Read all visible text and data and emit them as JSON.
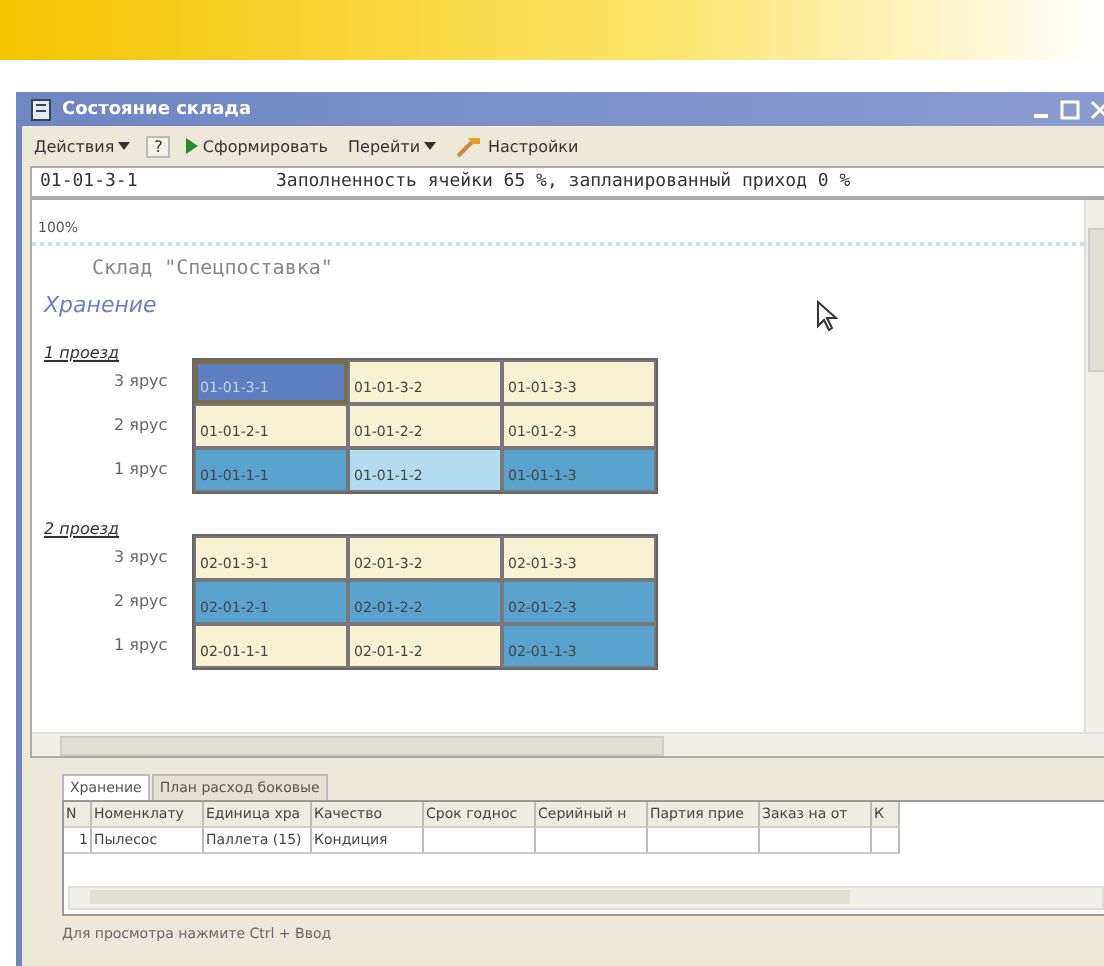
{
  "window": {
    "title": "Состояние склада"
  },
  "toolbar": [
    {
      "label": "Действия",
      "kind": "menu"
    },
    {
      "label": "?",
      "kind": "help"
    },
    {
      "label": "Сформировать",
      "kind": "run"
    },
    {
      "label": "Перейти",
      "kind": "menu"
    },
    {
      "label": "Настройки",
      "kind": "settings"
    }
  ],
  "info": {
    "cell": "01-01-3-1",
    "text": "Заполненность ячейки 65 %, запланированный приход 0 %"
  },
  "zoom": "100%",
  "report": {
    "title": "Склад \"Спецпоставка\"",
    "section": "Хранение",
    "aisles": [
      {
        "label": "1 проезд",
        "tiers": [
          {
            "label": "3 ярус",
            "cells": [
              {
                "code": "01-01-3-1",
                "color": "#5b7fc0",
                "selected": true
              },
              {
                "code": "01-01-3-2",
                "color": "#f7f2d4",
                "selected": false
              },
              {
                "code": "01-01-3-3",
                "color": "#f7f2d4",
                "selected": false
              }
            ]
          },
          {
            "label": "2 ярус",
            "cells": [
              {
                "code": "01-01-2-1",
                "color": "#f7f2d4",
                "selected": false
              },
              {
                "code": "01-01-2-2",
                "color": "#f7f2d4",
                "selected": false
              },
              {
                "code": "01-01-2-3",
                "color": "#f7f2d4",
                "selected": false
              }
            ]
          },
          {
            "label": "1 ярус",
            "cells": [
              {
                "code": "01-01-1-1",
                "color": "#5ba3cf",
                "selected": false
              },
              {
                "code": "01-01-1-2",
                "color": "#b3dcef",
                "selected": false
              },
              {
                "code": "01-01-1-3",
                "color": "#5ba3cf",
                "selected": false
              }
            ]
          }
        ]
      },
      {
        "label": "2 проезд",
        "tiers": [
          {
            "label": "3 ярус",
            "cells": [
              {
                "code": "02-01-3-1",
                "color": "#f7f2d4",
                "selected": false
              },
              {
                "code": "02-01-3-2",
                "color": "#f7f2d4",
                "selected": false
              },
              {
                "code": "02-01-3-3",
                "color": "#f7f2d4",
                "selected": false
              }
            ]
          },
          {
            "label": "2 ярус",
            "cells": [
              {
                "code": "02-01-2-1",
                "color": "#5ba3cf",
                "selected": false
              },
              {
                "code": "02-01-2-2",
                "color": "#5ba3cf",
                "selected": false
              },
              {
                "code": "02-01-2-3",
                "color": "#5ba3cf",
                "selected": false
              }
            ]
          },
          {
            "label": "1 ярус",
            "cells": [
              {
                "code": "02-01-1-1",
                "color": "#f7f2d4",
                "selected": false
              },
              {
                "code": "02-01-1-2",
                "color": "#f7f2d4",
                "selected": false
              },
              {
                "code": "02-01-1-3",
                "color": "#5ba3cf",
                "selected": false
              }
            ]
          }
        ]
      }
    ]
  },
  "tabs": [
    {
      "label": "Хранение",
      "selected": true
    },
    {
      "label": "План расход боковые",
      "selected": false
    }
  ],
  "table": {
    "columns": [
      "N",
      "Номенклату",
      "Единица хра",
      "Качество",
      "Срок годнос",
      "Серийный н",
      "Партия прие",
      "Заказ на от",
      "К"
    ],
    "rows": [
      [
        "1",
        "Пылесос",
        "Паллета (15)",
        "Кондиция",
        "",
        "",
        "",
        "",
        ""
      ]
    ]
  },
  "status_bar": "Для просмотра нажмите Ctrl + Ввод"
}
